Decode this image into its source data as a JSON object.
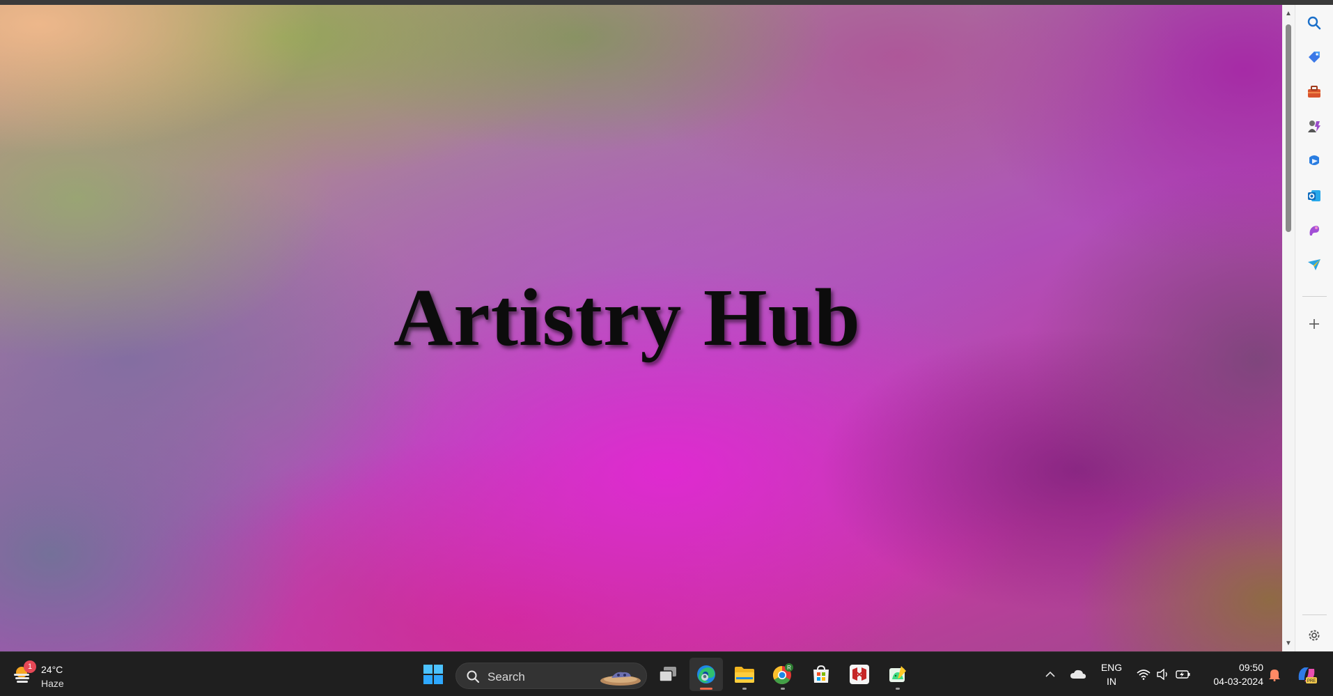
{
  "page": {
    "hero_title": "Artistry Hub"
  },
  "sidebar_icons": [
    "search-icon",
    "shopping-tag-icon",
    "toolbox-icon",
    "games-icon",
    "copilot-icon",
    "outlook-icon",
    "designer-icon",
    "telegram-icon",
    "add-icon",
    "settings-icon"
  ],
  "taskbar": {
    "weather": {
      "temperature": "24°C",
      "condition": "Haze",
      "badge": "1"
    },
    "search_placeholder": "Search",
    "apps": [
      "start-button",
      "task-view",
      "edge",
      "file-explorer",
      "chrome",
      "microsoft-store",
      "mcafee",
      "android-studio"
    ],
    "language": {
      "line1": "ENG",
      "line2": "IN"
    },
    "clock": {
      "time": "09:50",
      "date": "04-03-2024"
    }
  },
  "colors": {
    "accent_active": "#f06a4b",
    "taskbar_bg": "#1f1f1f"
  }
}
